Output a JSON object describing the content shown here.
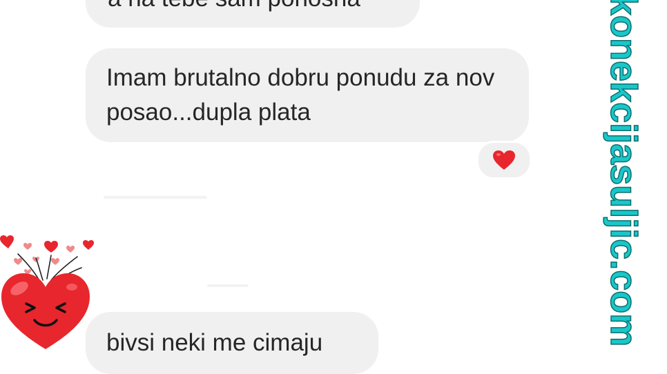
{
  "messages": [
    {
      "text": "a na tebe sam ponosna"
    },
    {
      "text": "Imam brutalno dobru ponudu za nov posao...dupla plata",
      "reaction": "red-heart-icon"
    },
    {
      "text": "bivsi neki me cimaju"
    }
  ],
  "watermark": {
    "text": "konekcijasuljic.com"
  },
  "colors": {
    "bubble_bg": "#f0f0f0",
    "text": "#262626",
    "watermark": "#19c7c9",
    "heart": "#e8262d"
  }
}
